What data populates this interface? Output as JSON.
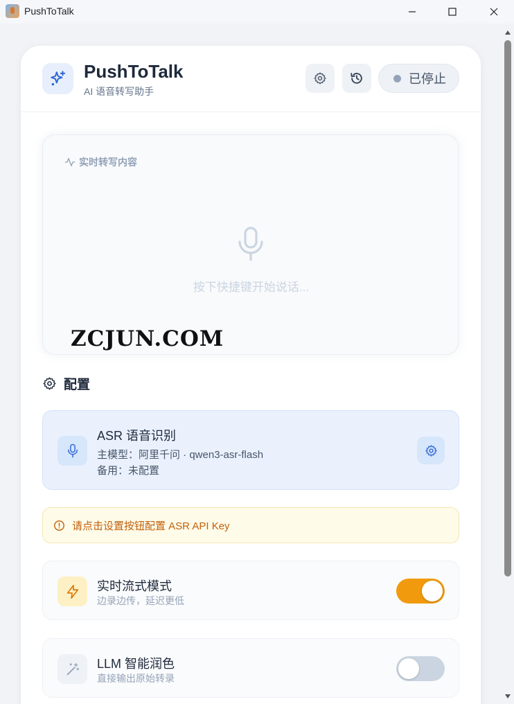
{
  "window": {
    "title": "PushToTalk"
  },
  "header": {
    "app_name": "PushToTalk",
    "subtitle": "AI 语音转写助手",
    "status": "已停止"
  },
  "transcript": {
    "label": "实时转写内容",
    "placeholder": "按下快捷键开始说话...",
    "watermark": "ZCJUN.COM"
  },
  "config": {
    "section_title": "配置",
    "asr": {
      "title": "ASR 语音识别",
      "primary_model": "主模型：阿里千问 · qwen3-asr-flash",
      "backup": "备用：未配置"
    },
    "warning": "请点击设置按钮配置 ASR API Key",
    "streaming": {
      "title": "实时流式模式",
      "subtitle": "边录边传，延迟更低",
      "enabled": true
    },
    "llm": {
      "title": "LLM 智能润色",
      "subtitle": "直接输出原始转录",
      "enabled": false
    }
  },
  "colors": {
    "accent_blue": "#3b6fd8",
    "accent_orange": "#f19a0d",
    "warning_text": "#c2600c"
  }
}
